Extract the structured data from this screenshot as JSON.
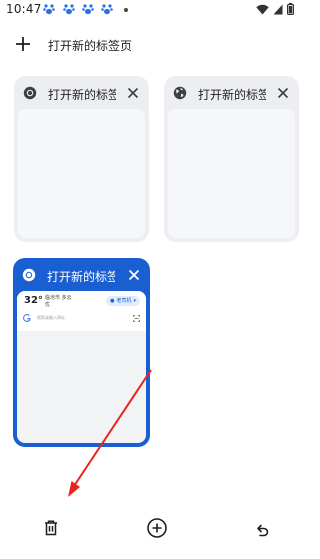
{
  "status_bar": {
    "time": "10:47",
    "notification_icons": [
      "baidu-paw-icon",
      "baidu-paw-icon",
      "baidu-paw-icon",
      "baidu-paw-icon"
    ],
    "system_icons": [
      "wifi-icon",
      "signal-icon",
      "battery-icon"
    ]
  },
  "new_tab": {
    "label": "打开新的标签页",
    "icon": "plus-icon"
  },
  "tabs": [
    {
      "title": "打开新的标签页",
      "favicon": "chrome-icon",
      "active": false
    },
    {
      "title": "打开新的标签页",
      "favicon": "globe-icon",
      "active": false
    },
    {
      "title": "打开新的标签页",
      "favicon": "chrome-icon",
      "active": true,
      "preview": {
        "temperature": "32°",
        "weather_line1": "临沧市 多云",
        "weather_line2": "优",
        "pill_label": "老司机",
        "search_placeholder": "搜索或输入网址"
      }
    }
  ],
  "bottom_bar": {
    "buttons": [
      "delete-icon",
      "add-tab-icon",
      "undo-icon"
    ]
  },
  "colors": {
    "accent": "#1a5fd1",
    "card_bg": "#eceef1",
    "annotation_arrow": "#e8241d"
  }
}
